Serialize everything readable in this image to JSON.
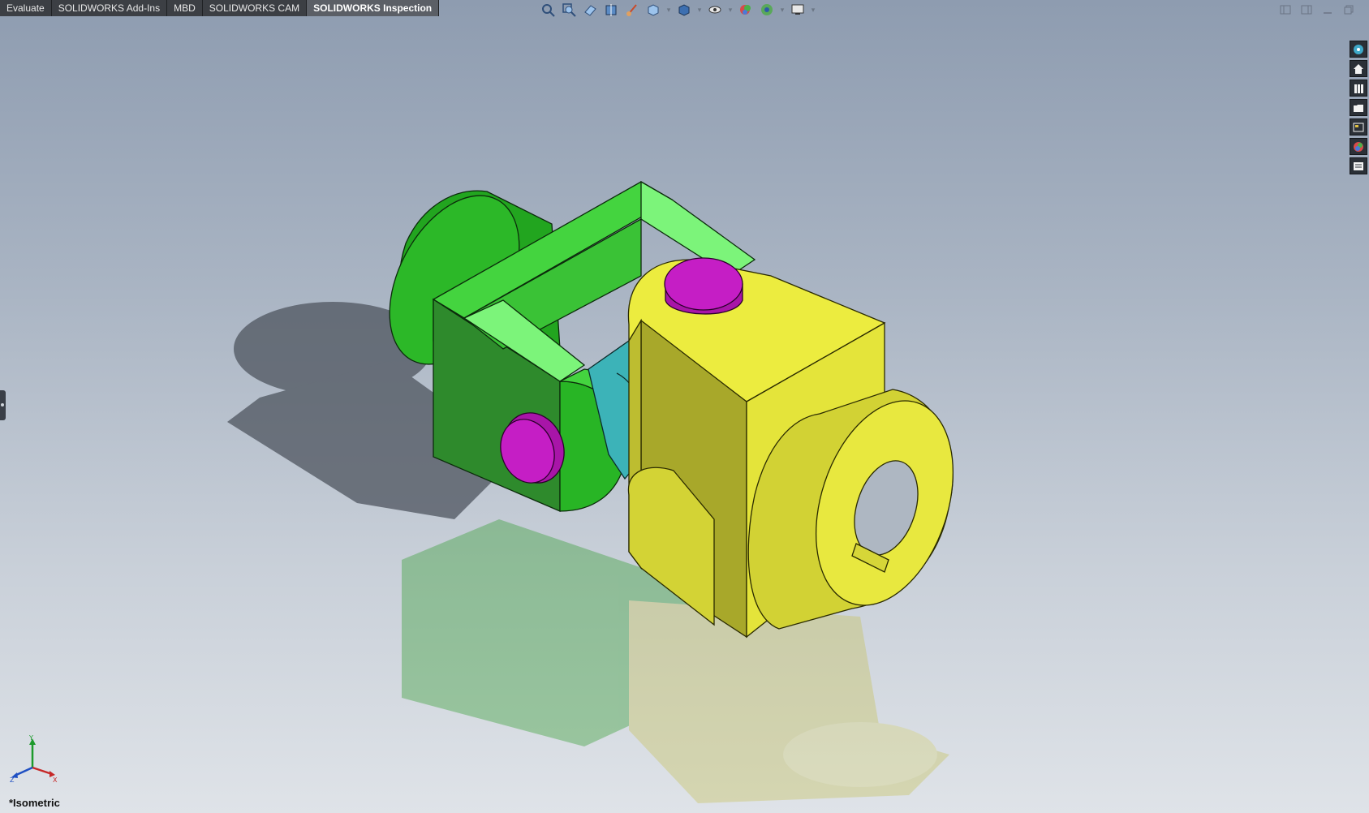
{
  "command_tabs": [
    {
      "label": "Evaluate",
      "active": false
    },
    {
      "label": "SOLIDWORKS Add-Ins",
      "active": false
    },
    {
      "label": "MBD",
      "active": false
    },
    {
      "label": "SOLIDWORKS CAM",
      "active": false
    },
    {
      "label": "SOLIDWORKS Inspection",
      "active": true
    }
  ],
  "hud_toolbar": {
    "items": [
      "zoom-to-fit-icon",
      "zoom-to-area-icon",
      "previous-view-icon",
      "section-view-icon",
      "dynamic-annotation-icon",
      "view-orientation-icon",
      "display-style-icon",
      "hide-show-items-icon",
      "edit-appearance-icon",
      "apply-scene-icon",
      "view-settings-icon"
    ]
  },
  "window_controls": [
    "tile-left-icon",
    "tile-right-icon",
    "minimize-icon",
    "restore-icon"
  ],
  "task_pane": {
    "items": [
      "solidworks-resources-icon",
      "home-icon",
      "design-library-icon",
      "file-explorer-icon",
      "view-palette-icon",
      "appearances-scenes-icon",
      "custom-properties-icon"
    ]
  },
  "view": {
    "orientation_label": "*Isometric",
    "triad_axes": [
      "Y",
      "X",
      "Z"
    ]
  },
  "model": {
    "name": "universal joint",
    "colors": {
      "yoke_green": "#2fbf2a",
      "yoke_yellow": "#e4e43a",
      "cross_cyan": "#3cb3b8",
      "pin_magenta": "#c51ec5"
    }
  }
}
